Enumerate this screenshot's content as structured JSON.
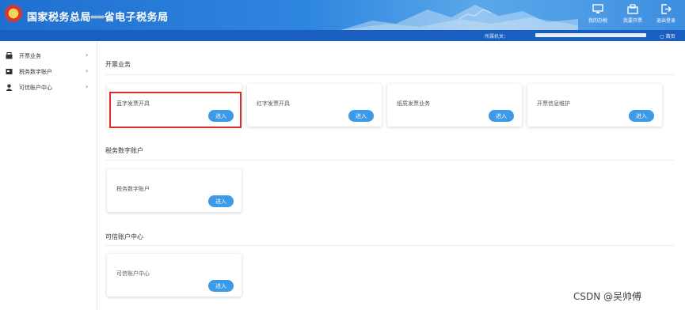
{
  "header": {
    "title": "国家税务总局══省电子税务局",
    "buttons": [
      {
        "icon": "monitor-icon",
        "label": "我的办税"
      },
      {
        "icon": "invoice-icon",
        "label": "我要开票"
      },
      {
        "icon": "logout-icon",
        "label": "退出登录"
      }
    ]
  },
  "subbar": {
    "org_label": "所属机关：",
    "home_label": "首页"
  },
  "sidebar": {
    "items": [
      {
        "icon": "invoice-icon",
        "label": "开票业务"
      },
      {
        "icon": "account-icon",
        "label": "税务数字账户"
      },
      {
        "icon": "user-icon",
        "label": "可信账户中心"
      }
    ]
  },
  "sections": [
    {
      "title": "开票业务",
      "cards": [
        {
          "label": "蓝字发票开具",
          "button": "进入"
        },
        {
          "label": "红字发票开具",
          "button": "进入"
        },
        {
          "label": "纸质发票业务",
          "button": "进入"
        },
        {
          "label": "开票信息维护",
          "button": "进入"
        }
      ]
    },
    {
      "title": "税务数字账户",
      "cards": [
        {
          "label": "税务数字账户",
          "button": "进入"
        }
      ]
    },
    {
      "title": "可信账户中心",
      "cards": [
        {
          "label": "可信账户中心",
          "button": "进入"
        }
      ]
    }
  ],
  "watermark": "CSDN @吴帅傅",
  "colors": {
    "header_blue": "#2f86df",
    "button_blue": "#3b9be8",
    "highlight_red": "#d9302f"
  }
}
